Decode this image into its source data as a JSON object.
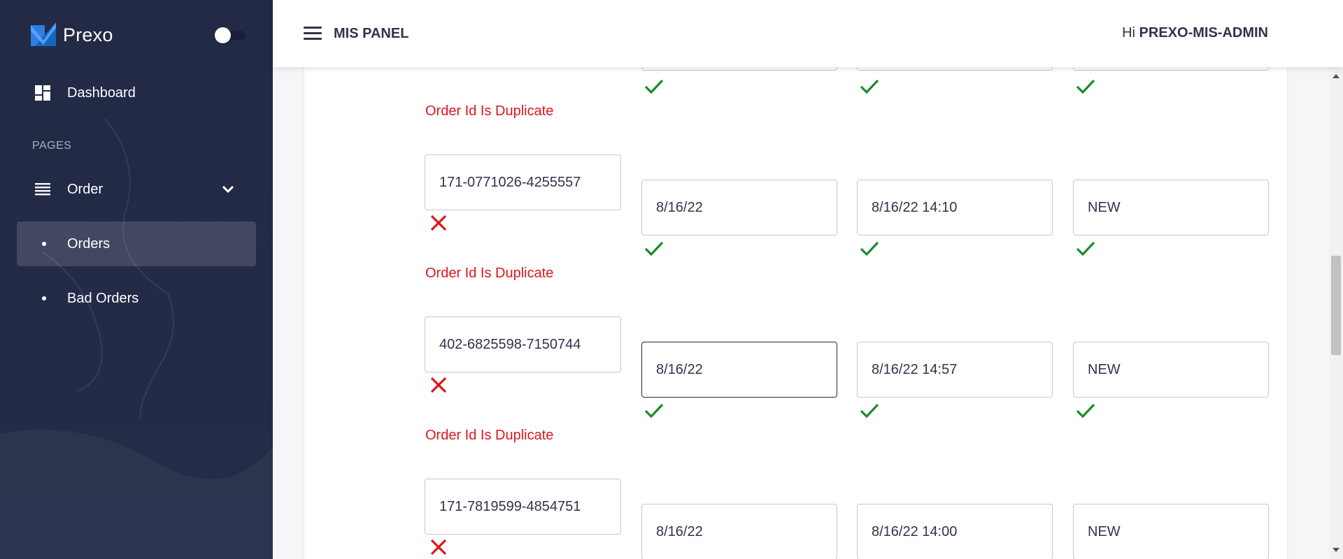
{
  "sidebar": {
    "brand": "Prexo",
    "section_label": "PAGES",
    "items": [
      {
        "label": "Dashboard",
        "icon": "dashboard-icon"
      },
      {
        "label": "Order",
        "icon": "list-icon"
      },
      {
        "label": "Orders",
        "icon": "bullet-icon",
        "active": true
      },
      {
        "label": "Bad Orders",
        "icon": "bullet-icon"
      }
    ]
  },
  "topbar": {
    "title": "MIS PANEL",
    "greeting_prefix": "Hi",
    "user": "PREXO-MIS-ADMIN"
  },
  "rows": [
    {
      "error": "Order Id Is Duplicate"
    },
    {
      "order_id": "171-0771026-4255557",
      "order_valid": false,
      "date": "8/16/22",
      "datetime": "8/16/22 14:10",
      "status": "NEW",
      "error": "Order Id Is Duplicate"
    },
    {
      "order_id": "402-6825598-7150744",
      "order_valid": false,
      "date": "8/16/22",
      "datetime": "8/16/22 14:57",
      "status": "NEW",
      "error": "Order Id Is Duplicate"
    },
    {
      "order_id": "171-7819599-4854751",
      "order_valid": false,
      "date": "8/16/22",
      "datetime": "8/16/22 14:00",
      "status": "NEW"
    }
  ],
  "colors": {
    "sidebar_bg": "#222a45",
    "error": "#e0141c",
    "valid": "#1b8a2a"
  }
}
